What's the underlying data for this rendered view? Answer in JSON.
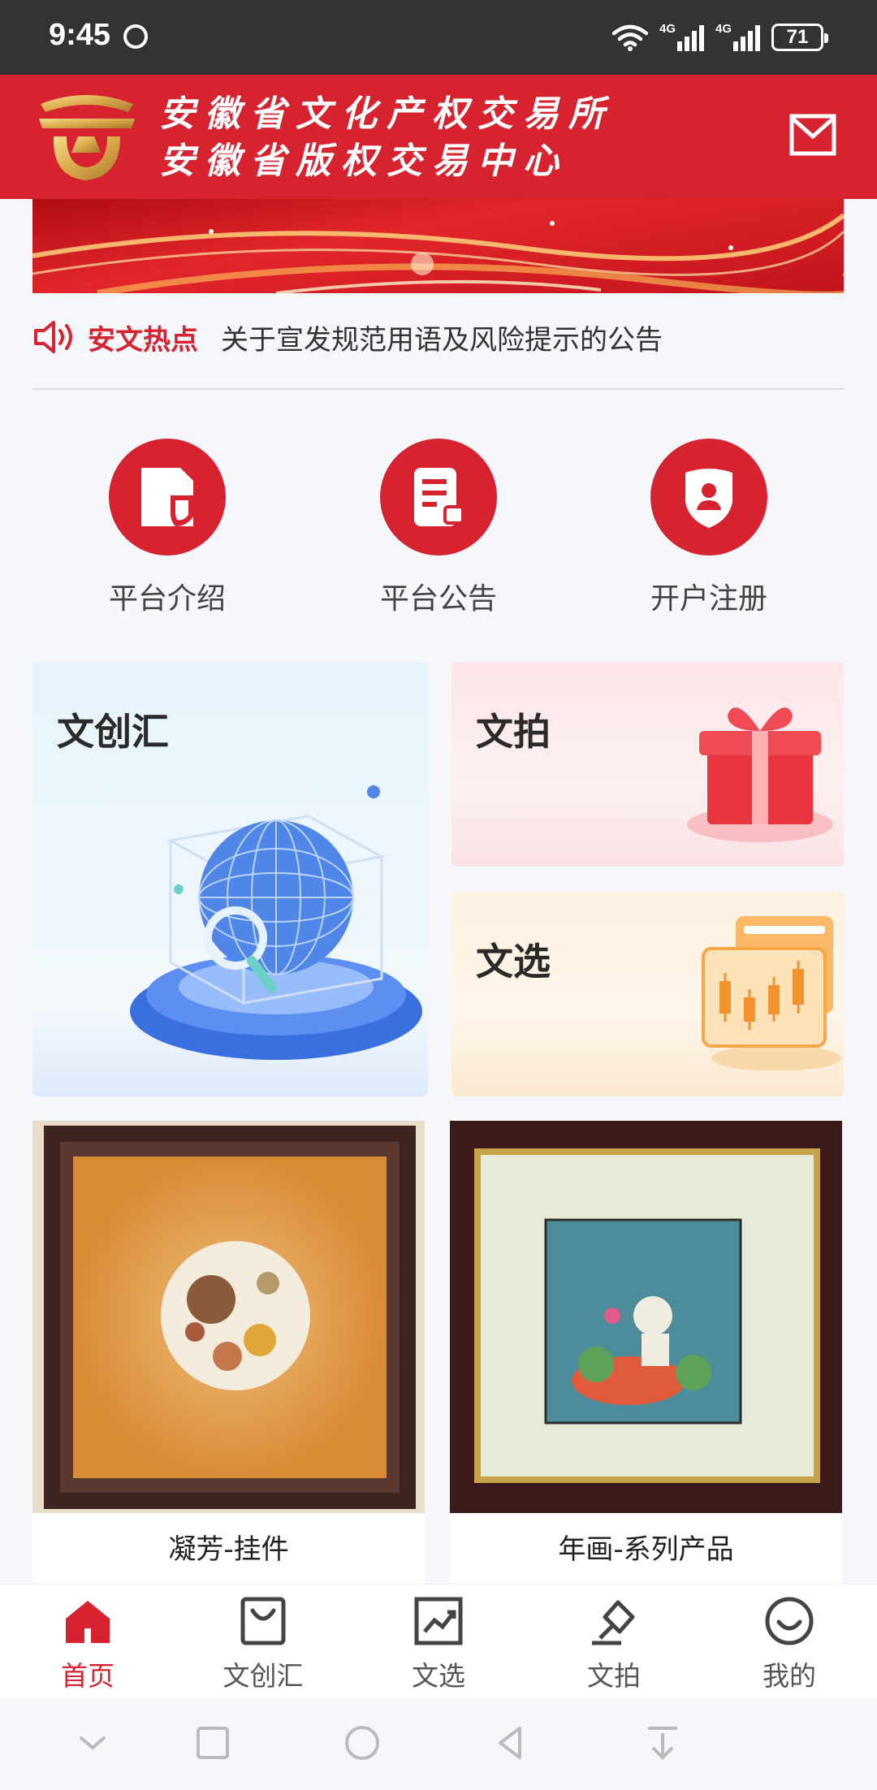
{
  "status_bar": {
    "time": "9:45",
    "network_1": "4G",
    "network_2": "4G",
    "battery": "71"
  },
  "header": {
    "title_line1": "安徽省文化产权交易所",
    "title_line2": "安徽省版权交易中心",
    "logo_icon": "logo-icon",
    "mail_icon": "mail-icon"
  },
  "hot_news": {
    "label": "安文热点",
    "text": "关于宣发规范用语及风险提示的公告"
  },
  "quick_links": [
    {
      "label": "平台介绍",
      "icon": "document-icon"
    },
    {
      "label": "平台公告",
      "icon": "notice-icon"
    },
    {
      "label": "开户注册",
      "icon": "user-shield-icon"
    }
  ],
  "feature_cards": {
    "big": {
      "title": "文创汇"
    },
    "top_right": {
      "title": "文拍"
    },
    "bottom_right": {
      "title": "文选"
    }
  },
  "products": [
    {
      "name": "凝芳-挂件"
    },
    {
      "name": "年画-系列产品"
    }
  ],
  "tabs": [
    {
      "label": "首页",
      "icon": "home-icon",
      "active": true
    },
    {
      "label": "文创汇",
      "icon": "bag-icon",
      "active": false
    },
    {
      "label": "文选",
      "icon": "chart-icon",
      "active": false
    },
    {
      "label": "文拍",
      "icon": "gavel-icon",
      "active": false
    },
    {
      "label": "我的",
      "icon": "smile-icon",
      "active": false
    }
  ],
  "colors": {
    "brand": "#d7232f",
    "status_bar": "#333333",
    "tab_active": "#d7232f"
  }
}
